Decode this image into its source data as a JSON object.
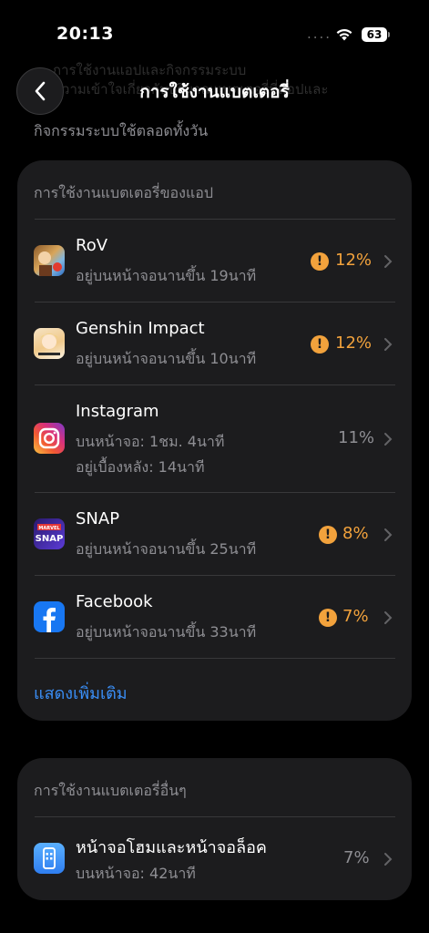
{
  "status": {
    "time": "20:13",
    "dots": "....",
    "battery": "63"
  },
  "header": {
    "title": "การใช้งานแบตเตอรี่",
    "subtitle": "กิจกรรมระบบใช้ตลอดทั้งวัน",
    "faded_line1": "การใช้งานแอปและกิจกรรมระบบ",
    "faded_line2": "ความเข้าใจเกี่ยวกับปริมาณแบตเตอรี่ที่แอปและ"
  },
  "app_usage": {
    "header": "การใช้งานแบตเตอรี่ของแอป",
    "items": [
      {
        "name": "RoV",
        "sub1": "อยู่บนหน้าจอนานขึ้น 19นาที",
        "sub2": "",
        "percent": "12%",
        "warning": true
      },
      {
        "name": "Genshin Impact",
        "sub1": "อยู่บนหน้าจอนานขึ้น 10นาที",
        "sub2": "",
        "percent": "12%",
        "warning": true
      },
      {
        "name": "Instagram",
        "sub1": "บนหน้าจอ: 1ชม. 4นาที",
        "sub2": "อยู่เบื้องหลัง: 14นาที",
        "percent": "11%",
        "warning": false
      },
      {
        "name": "SNAP",
        "sub1": "อยู่บนหน้าจอนานขึ้น 25นาที",
        "sub2": "",
        "percent": "8%",
        "warning": true
      },
      {
        "name": "Facebook",
        "sub1": "อยู่บนหน้าจอนานขึ้น 33นาที",
        "sub2": "",
        "percent": "7%",
        "warning": true
      }
    ],
    "show_more": "แสดงเพิ่มเติม"
  },
  "other_usage": {
    "header": "การใช้งานแบตเตอรี่อื่นๆ",
    "items": [
      {
        "name": "หน้าจอโฮมและหน้าจอล็อค",
        "sub1": "บนหน้าจอ: 42นาที",
        "percent": "7%"
      }
    ]
  },
  "icon_labels": {
    "snap_line1": "MARVEL",
    "snap_line2": "SNAP"
  },
  "colors": {
    "warning": "#f2a23c",
    "link": "#3a8ef6",
    "card": "#1c1c1e",
    "secondary_text": "#8e8e93"
  }
}
